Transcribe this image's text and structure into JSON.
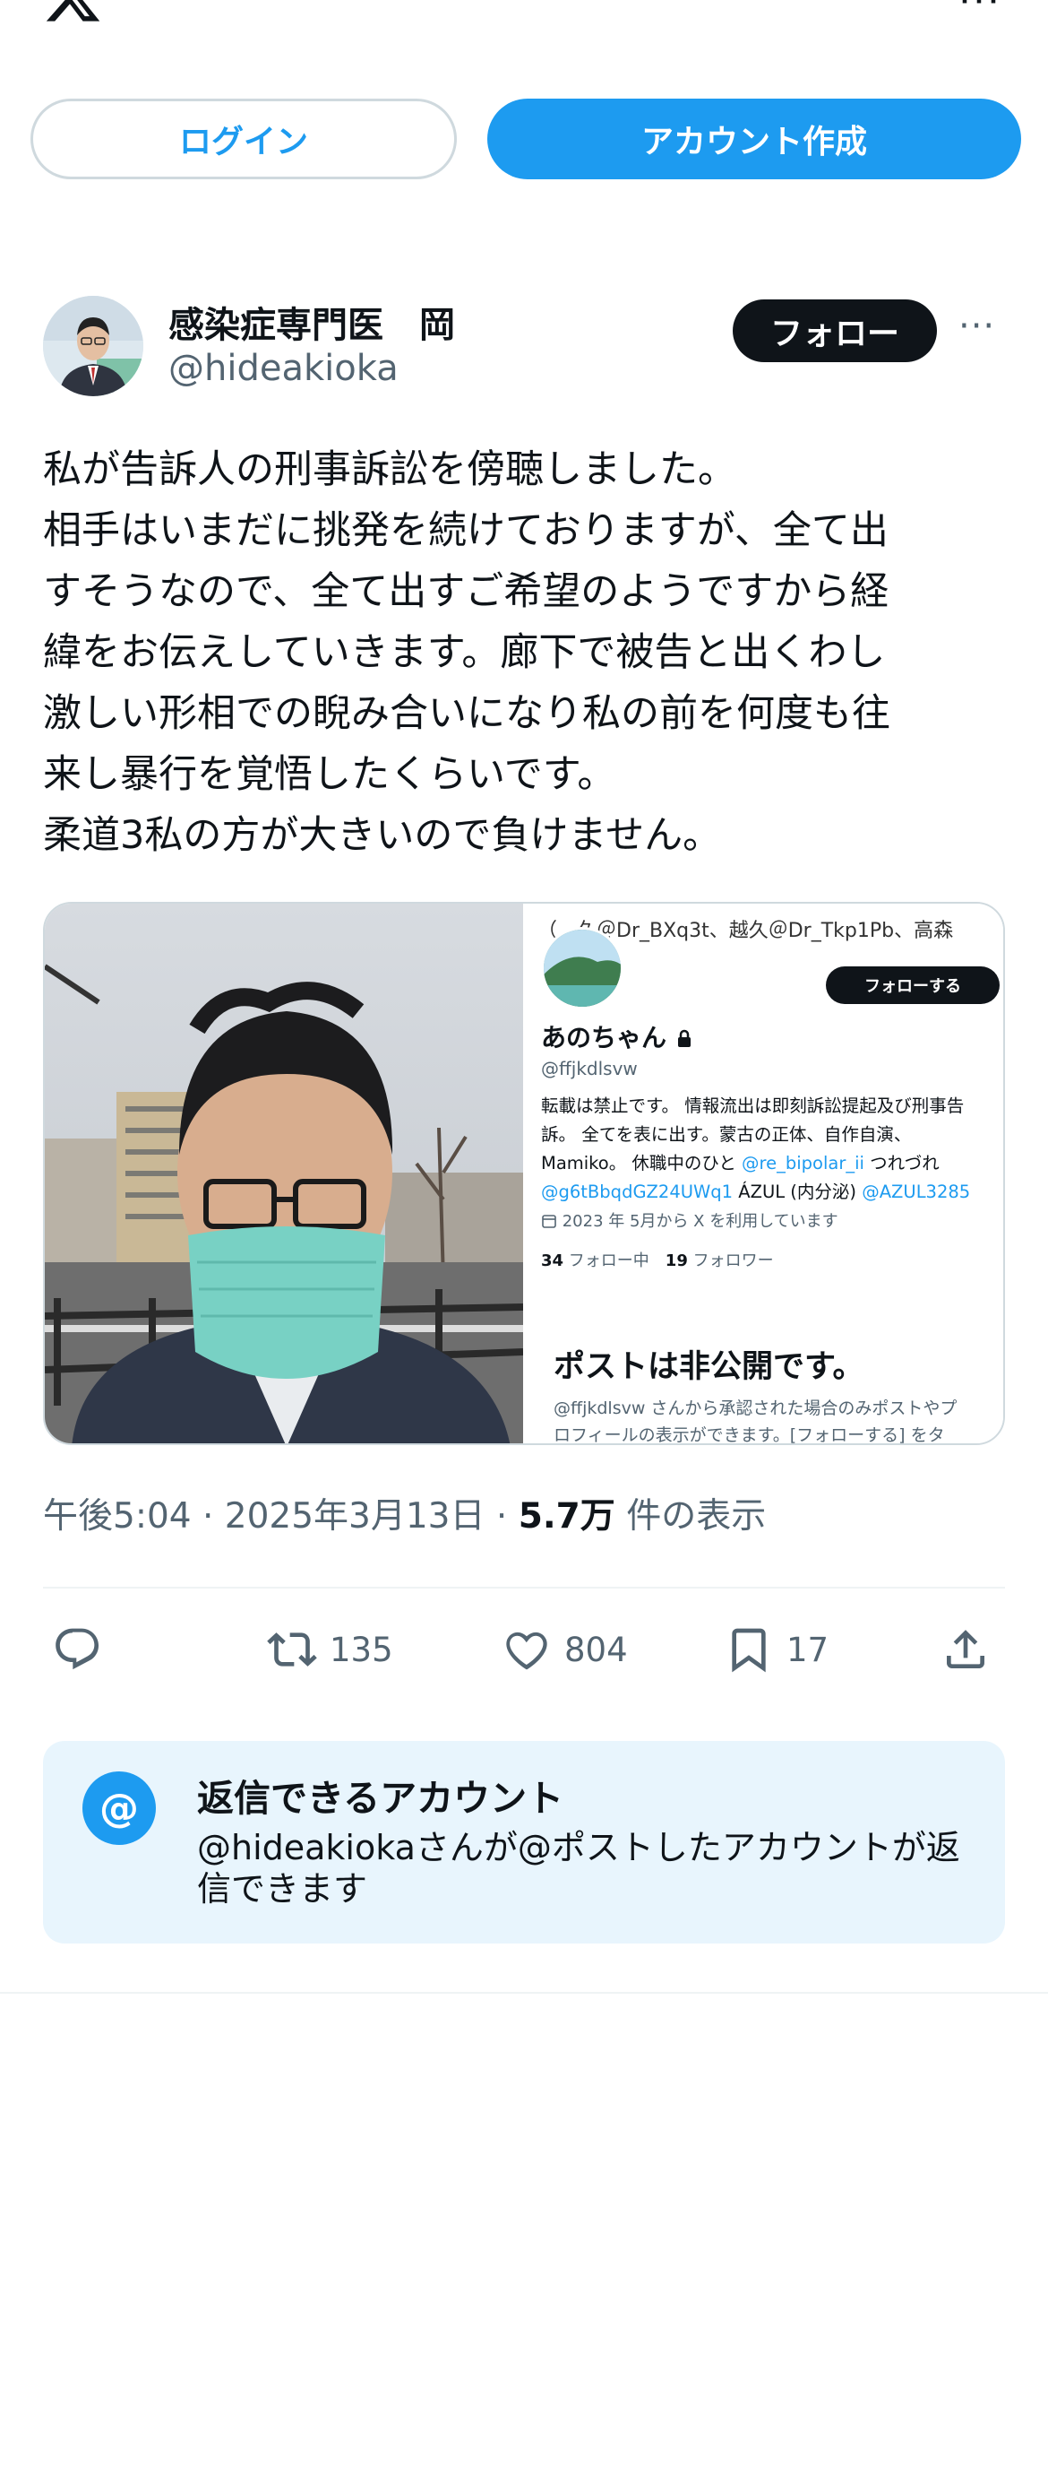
{
  "topbar": {
    "logo": "x-logo",
    "more": "···"
  },
  "auth": {
    "login_label": "ログイン",
    "signup_label": "アカウント作成"
  },
  "author": {
    "name": "感染症専門医　岡",
    "handle": "@hideakioka",
    "follow_label": "フォロー",
    "more": "···"
  },
  "post": {
    "lines": [
      "私が告訴人の刑事訴訟を傍聴しました。",
      "相手はいまだに挑発を続けておりますが、全て出",
      "すそうなので、全て出すご希望のようですから経",
      "緯をお伝えしていきます。廊下で被告と出くわし",
      "激しい形相での睨み合いになり私の前を何度も往",
      "来し暴行を覚悟したくらいです。",
      "柔道3私の方が大きいので負けません。"
    ]
  },
  "embedded_profile": {
    "top_text": "（　久＠Dr_BXq3t、越久＠Dr_Tkp1Pb、高森",
    "follow_label": "フォローする",
    "name": "あのちゃん",
    "handle": "@ffjkdlsvw",
    "bio_line1": "転載は禁止です。 情報流出は即刻訴訟提起及び刑事告",
    "bio_line2": "訴。 全てを表に出す。蒙古の正体、自作自演、",
    "bio_line3_a": "Mamiko。 休職中のひと ",
    "bio_line3_link": "@re_bipolar_ii",
    "bio_line3_b": " つれづれ",
    "bio_line4_link1": "@g6tBbqdGZ24UWq1",
    "bio_line4_mid": " ÁZUL (内分泌) ",
    "bio_line4_link2": "@AZUL3285",
    "joined": "2023 年 5月から X を利用しています",
    "following_count": "34",
    "following_label": " フォロー中　",
    "followers_count": "19",
    "followers_label": " フォロワー",
    "private_title": "ポストは非公開です。",
    "private_desc1": "@ffjkdlsvw さんから承認された場合のみポストやプ",
    "private_desc2": "ロフィールの表示ができます。[フォローする] をタ"
  },
  "meta": {
    "time": "午後5:04",
    "sep1": " · ",
    "date": "2025年3月13日",
    "sep2": " · ",
    "views": "5.7万",
    "views_label": " 件の表示"
  },
  "actions": {
    "retweets": "135",
    "likes": "804",
    "bookmarks": "17"
  },
  "reply_restriction": {
    "title": "返信できるアカウント",
    "desc": "@hideakiokaさんが@ポストしたアカウントが返信できます"
  },
  "colors": {
    "accent": "#1d9bf0",
    "text": "#0f1419",
    "muted": "#536471",
    "reply_bg": "#e8f5fd"
  }
}
